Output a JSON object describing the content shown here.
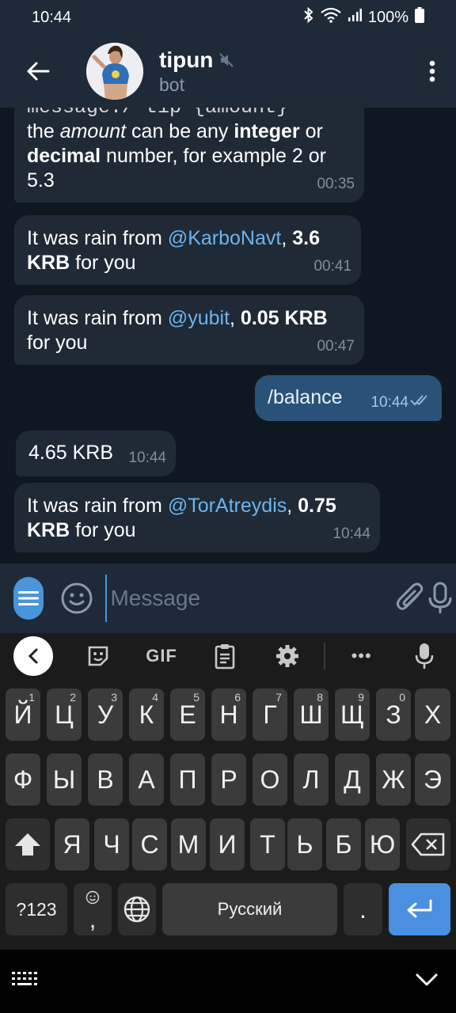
{
  "status": {
    "time": "10:44",
    "battery": "100%"
  },
  "header": {
    "title": "tipun",
    "subtitle": "bot"
  },
  "messages": {
    "m1": {
      "line1": "message:/ tip {amount}",
      "line2a": "the ",
      "line2b": "amount",
      "line2c": " can be any ",
      "line2d": "integer",
      "line2e": " or",
      "line3a": "decimal",
      "line3b": " number, for example 2 or",
      "line4": "5.3",
      "time": "00:35"
    },
    "m2": {
      "prefix": "It was rain from ",
      "user": "@KarboNavt",
      "sep": ", ",
      "amount": "3.6",
      "amount2": "KRB",
      "suffix": " for you",
      "time": "00:41"
    },
    "m3": {
      "prefix": "It was rain from ",
      "user": "@yubit",
      "sep": ", ",
      "amount": "0.05 KRB",
      "suffix": "for you",
      "time": "00:47"
    },
    "m4": {
      "text": "/balance",
      "time": "10:44"
    },
    "m5": {
      "text": "4.65 KRB",
      "time": "10:44"
    },
    "m6": {
      "prefix": "It was rain from ",
      "user": "@TorAtreydis",
      "sep": ", ",
      "amount": "0.75",
      "amount2": "KRB",
      "suffix": " for you",
      "time": "10:44"
    }
  },
  "input": {
    "placeholder": "Message"
  },
  "keyboard": {
    "toolbar": {
      "gif": "GIF",
      "more": "•••"
    },
    "row1": [
      {
        "k": "Й",
        "h": "1"
      },
      {
        "k": "Ц",
        "h": "2"
      },
      {
        "k": "У",
        "h": "3"
      },
      {
        "k": "К",
        "h": "4"
      },
      {
        "k": "Е",
        "h": "5"
      },
      {
        "k": "Н",
        "h": "6"
      },
      {
        "k": "Г",
        "h": "7"
      },
      {
        "k": "Ш",
        "h": "8"
      },
      {
        "k": "Щ",
        "h": "9"
      },
      {
        "k": "З",
        "h": "0"
      },
      {
        "k": "Х",
        "h": ""
      }
    ],
    "row2": [
      "Ф",
      "Ы",
      "В",
      "А",
      "П",
      "Р",
      "О",
      "Л",
      "Д",
      "Ж",
      "Э"
    ],
    "row3": [
      "Я",
      "Ч",
      "С",
      "М",
      "И",
      "Т",
      "Ь",
      "Б",
      "Ю"
    ],
    "numbers_key": "?123",
    "comma_key": ",",
    "space_label": "Русский",
    "period_key": "."
  }
}
